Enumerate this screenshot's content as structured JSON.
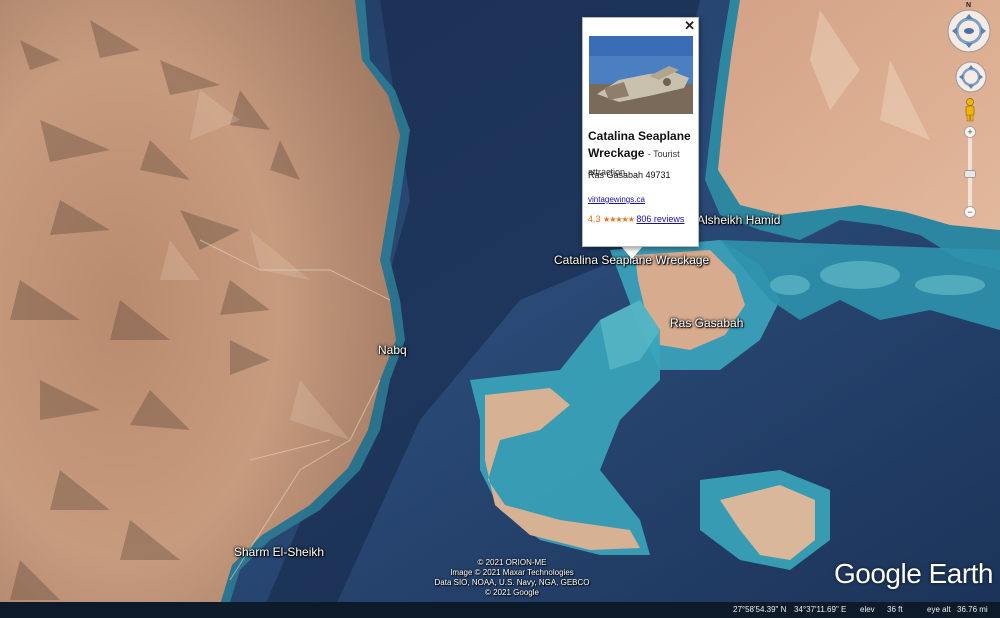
{
  "map": {
    "labels": {
      "nabq": "Nabq",
      "sharm": "Sharm El-Sheikh",
      "alsheikh_hamid": "Alsheikh Hamid",
      "catalina": "Catalina Seaplane Wreckage",
      "ras_gasabah": "Ras Gasabah"
    }
  },
  "popup": {
    "close_glyph": "✕",
    "title": "Catalina Seaplane Wreckage",
    "category": "- Tourist attraction",
    "address": "Ras Gasabah 49731",
    "website": "vintagewings.ca",
    "rating": "4.3",
    "stars": "★★★★★",
    "reviews": "806 reviews"
  },
  "navigation": {
    "north_label": "N",
    "zoom_in": "+",
    "zoom_out": "−"
  },
  "attribution": {
    "line1": "© 2021 ORION-ME",
    "line2": "Image © 2021 Maxar Technologies",
    "line3": "Data SIO, NOAA, U.S. Navy, NGA, GEBCO",
    "line4": "© 2021 Google"
  },
  "logo": "Google Earth",
  "status": {
    "lat": "27°58'54.39\" N",
    "lon": "34°37'11.69\" E",
    "elev_label": "elev",
    "elev_value": "36 ft",
    "eye_label": "eye alt",
    "eye_value": "36.76 mi"
  },
  "colors": {
    "sea": "#1d3458",
    "desert": "#c99a78",
    "reef": "#3aa0b8",
    "rating": "#e7711b",
    "link": "#1a0dab"
  }
}
